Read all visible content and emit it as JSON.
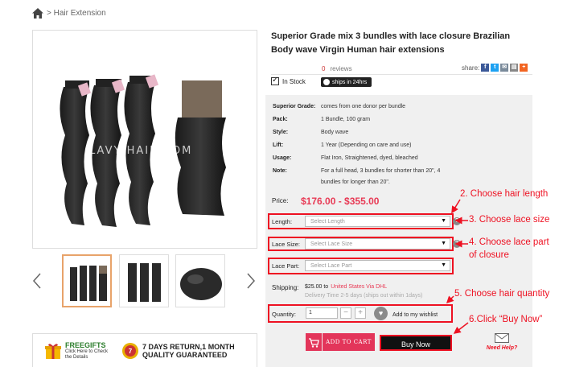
{
  "breadcrumb": {
    "current": "> Hair Extension"
  },
  "main_image": {
    "watermark": "LAVY HAIR.COM"
  },
  "product": {
    "title": "Superior Grade mix 3 bundles with lace closure Brazilian Body wave Virgin Human hair extensions",
    "reviews_count": "0",
    "reviews_label": "reviews",
    "share_label": "share:",
    "stock": "In Stock",
    "ships_badge": "ships in 24hrs"
  },
  "specs": [
    {
      "key": "Superior Grade:",
      "value": "comes from one donor per bundle"
    },
    {
      "key": "Pack:",
      "value": "1 Bundle, 100 gram"
    },
    {
      "key": "Style:",
      "value": "Body wave"
    },
    {
      "key": "Lift:",
      "value": "1 Year (Depending on care and use)"
    },
    {
      "key": "Usage:",
      "value": "Flat Iron, Straightened, dyed, bleached"
    },
    {
      "key": "Note:",
      "value": "For a full head, 3 bundles for shorter than 20\", 4 bundles for longer than 20\"."
    }
  ],
  "price": {
    "label": "Price:",
    "value": "$176.00 - $355.00"
  },
  "options": {
    "length": {
      "label": "Length:",
      "placeholder": "Select Length"
    },
    "lace_size": {
      "label": "Lace Size:",
      "placeholder": "Select Lace Size"
    },
    "lace_part": {
      "label": "Lace Part:",
      "placeholder": "Select Lace Part"
    }
  },
  "shipping": {
    "label": "Shipping:",
    "cost": "$25.00 to",
    "destination": "United States Via DHL",
    "time": "Delivery Time 2-5 days (ships out within 1days)"
  },
  "quantity": {
    "label": "Quantity:",
    "value": "1",
    "minus": "−",
    "plus": "+"
  },
  "wishlist": {
    "label": "Add to my wishlist"
  },
  "buttons": {
    "add_to_cart": "ADD TO CART",
    "buy_now": "Buy Now",
    "need_help": "Need Help?"
  },
  "promo": {
    "free_gifts_title": "FREEGIFTS",
    "free_gifts_sub": "Click Here to Check the Details",
    "return_title": "7 DAYS RETURN,1 MONTH",
    "return_sub": "QUALITY GUARANTEED"
  },
  "annotations": {
    "step2": "2. Choose hair length",
    "step3": "3. Choose lace size",
    "step4a": "4. Choose lace part",
    "step4b": "of closure",
    "step5": "5. Choose hair quantity",
    "step6": "6.Click “Buy Now”"
  },
  "colors": {
    "accent_red": "#e12222",
    "price_pink": "#e83a55",
    "button_pink": "#e3355a"
  },
  "icons": [
    "home-icon",
    "chevron-left-icon",
    "chevron-right-icon",
    "facebook-icon",
    "twitter-icon",
    "email-icon",
    "print-icon",
    "plus-share-icon",
    "clock-icon",
    "help-icon",
    "heart-icon",
    "cart-icon",
    "envelope-icon",
    "gift-icon",
    "guarantee-badge-icon"
  ]
}
